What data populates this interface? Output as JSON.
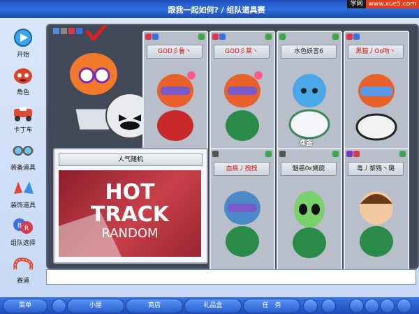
{
  "window": {
    "title": "跟我一起如何? / 组队道具赛"
  },
  "watermark": {
    "left": "学网",
    "right": "www.xue5.com"
  },
  "sidebar": {
    "items": [
      {
        "label": "开始",
        "icon": "play-icon"
      },
      {
        "label": "角色",
        "icon": "character-icon"
      },
      {
        "label": "卡丁车",
        "icon": "kart-icon"
      },
      {
        "label": "装备道具",
        "icon": "goggles-icon"
      },
      {
        "label": "装饰道具",
        "icon": "wings-icon"
      },
      {
        "label": "组队选择",
        "icon": "team-icon"
      },
      {
        "label": "赛道",
        "icon": "track-icon"
      }
    ]
  },
  "slots": [
    {
      "name": "GOD彡鲁丶",
      "highlight": true
    },
    {
      "name": "GOD彡莱丶",
      "highlight": true
    },
    {
      "name": "水色妖言6",
      "highlight": false,
      "status": "准备"
    },
    {
      "name": "黑猫丿Oo吻丶",
      "highlight": true
    },
    {
      "name": "血痕丿拽拽",
      "highlight": true
    },
    {
      "name": "魅惑0ε旖旎",
      "highlight": false
    },
    {
      "name": "毒丿黎殇丶璐",
      "highlight": false
    }
  ],
  "track": {
    "header": "人气随机",
    "title_line1": "HOT",
    "title_line2": "TRACK",
    "title_line3": "RANDOM"
  },
  "chat": {
    "value": ""
  },
  "taskbar": {
    "menu": "菜单",
    "home": "小屋",
    "shop": "商店",
    "gift": "礼品盒",
    "task": "任　务"
  }
}
